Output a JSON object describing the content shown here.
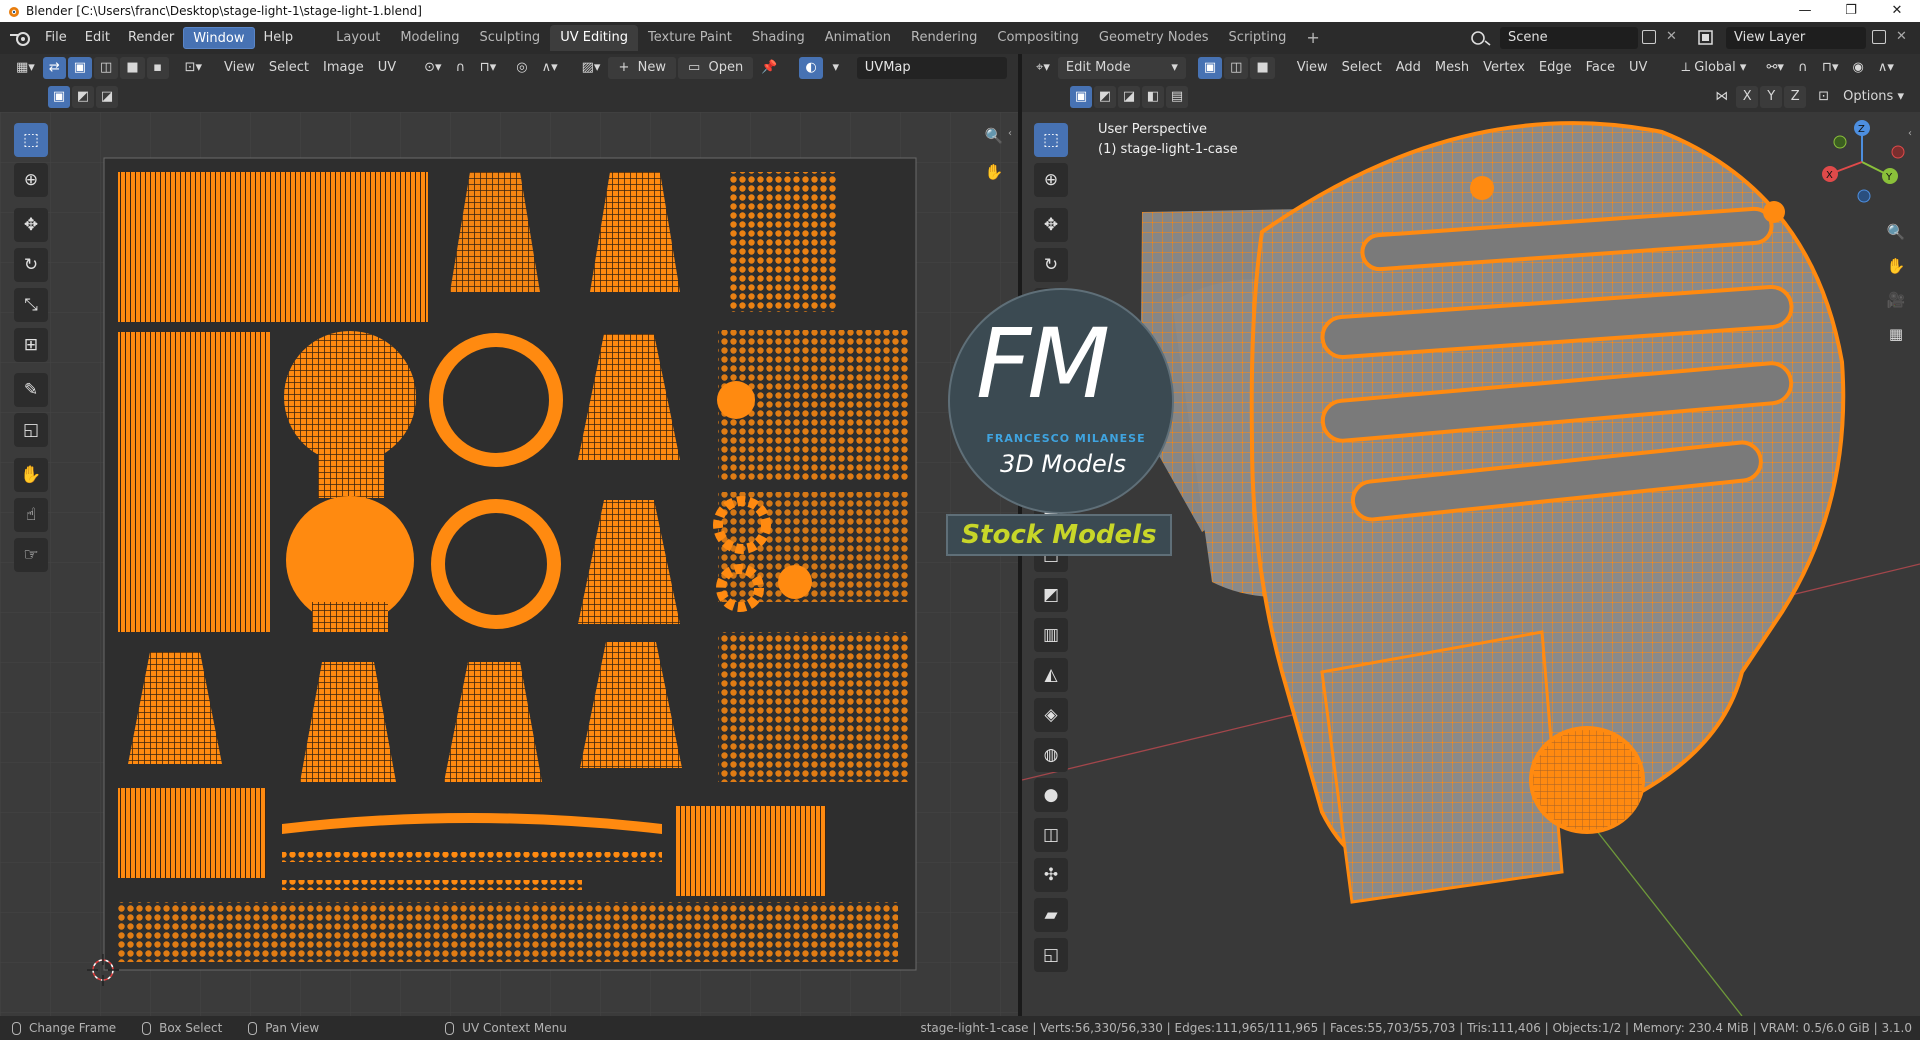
{
  "window": {
    "title": "Blender [C:\\Users\\franc\\Desktop\\stage-light-1\\stage-light-1.blend]",
    "controls": [
      "—",
      "❐",
      "✕"
    ]
  },
  "menu": {
    "items": [
      "File",
      "Edit",
      "Render",
      "Window",
      "Help"
    ],
    "active": "Window"
  },
  "workspaces": {
    "tabs": [
      "Layout",
      "Modeling",
      "Sculpting",
      "UV Editing",
      "Texture Paint",
      "Shading",
      "Animation",
      "Rendering",
      "Compositing",
      "Geometry Nodes",
      "Scripting"
    ],
    "active": "UV Editing",
    "add": "+"
  },
  "scene": {
    "name": "Scene",
    "view_layer": "View Layer"
  },
  "uv_editor": {
    "menus": [
      "View",
      "Select",
      "Image",
      "UV"
    ],
    "new_label": "New",
    "open_label": "Open",
    "uvmap": "UVMap"
  },
  "viewport": {
    "mode": "Edit Mode",
    "menus": [
      "View",
      "Select",
      "Add",
      "Mesh",
      "Vertex",
      "Edge",
      "Face",
      "UV"
    ],
    "orientation": "Global",
    "options_label": "Options",
    "axes": [
      "X",
      "Y",
      "Z"
    ],
    "perspective": "User Perspective",
    "object": "(1) stage-light-1-case"
  },
  "watermark": {
    "brand": "FM",
    "name": "FRANCESCO MILANESE",
    "subtitle": "3D Models",
    "banner": "Stock Models"
  },
  "status": {
    "left": [
      "Change Frame",
      "Box Select",
      "Pan View",
      "UV Context Menu"
    ],
    "stats": "stage-light-1-case | Verts:56,330/56,330 | Edges:111,965/111,965 | Faces:55,703/55,703 | Tris:111,406 | Objects:1/2 | Memory: 230.4 MiB | VRAM: 0.5/6.0 GiB | 3.1.0"
  },
  "colors": {
    "accent": "#4772b3",
    "selection": "#ff8a10",
    "uv_bg": "#3b3b3b",
    "viewport_bg": "#393939"
  }
}
